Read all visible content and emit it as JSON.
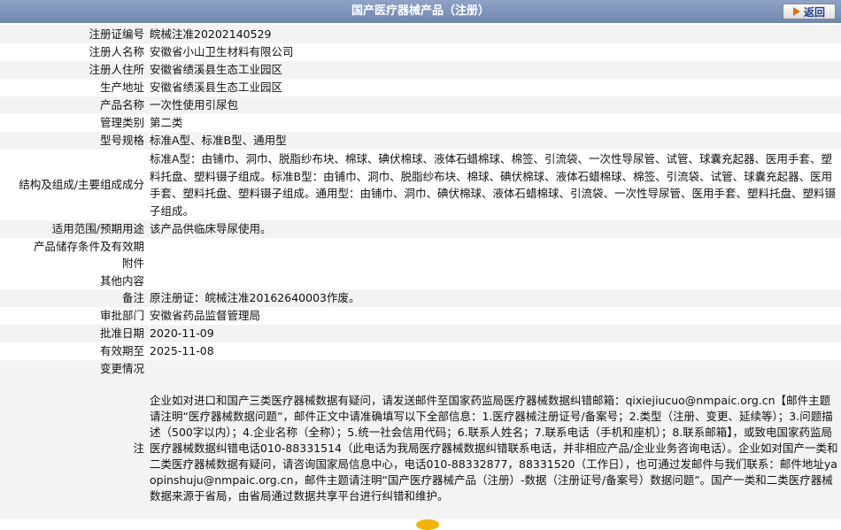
{
  "header": {
    "title": "国产医疗器械产品（注册）",
    "back_label": "返回"
  },
  "rows": [
    {
      "label": "注册证编号",
      "value": "皖械注准20202140529"
    },
    {
      "label": "注册人名称",
      "value": "安徽省小山卫生材料有限公司"
    },
    {
      "label": "注册人住所",
      "value": "安徽省绩溪县生态工业园区"
    },
    {
      "label": "生产地址",
      "value": "安徽省绩溪县生态工业园区"
    },
    {
      "label": "产品名称",
      "value": "一次性使用引尿包"
    },
    {
      "label": "管理类别",
      "value": "第二类"
    },
    {
      "label": "型号规格",
      "value": "标准A型、标准B型、通用型"
    },
    {
      "label": "结构及组成/主要组成成分",
      "value": "标准A型：由铺巾、洞巾、脱脂纱布块、棉球、碘伏棉球、液体石蜡棉球、棉签、引流袋、一次性导尿管、试管、球囊充起器、医用手套、塑料托盘、塑料镊子组成。标准B型：由铺巾、洞巾、脱脂纱布块、棉球、碘伏棉球、液体石蜡棉球、棉签、引流袋、试管、球囊充起器、医用手套、塑料托盘、塑料镊子组成。通用型：由铺巾、洞巾、碘伏棉球、液体石蜡棉球、引流袋、一次性导尿管、医用手套、塑料托盘、塑料镊子组成。"
    },
    {
      "label": "适用范围/预期用途",
      "value": "该产品供临床导尿使用。"
    },
    {
      "label": "产品储存条件及有效期",
      "value": ""
    },
    {
      "label": "附件",
      "value": ""
    },
    {
      "label": "其他内容",
      "value": ""
    },
    {
      "label": "备注",
      "value": "原注册证：皖械注准20162640003作废。"
    },
    {
      "label": "审批部门",
      "value": "安徽省药品监督管理局"
    },
    {
      "label": "批准日期",
      "value": "2020-11-09"
    },
    {
      "label": "有效期至",
      "value": "2025-11-08"
    },
    {
      "label": "变更情况",
      "value": ""
    }
  ],
  "notes": {
    "label": "注",
    "text": "企业如对进口和国产三类医疗器械数据有疑问，请发送邮件至国家药监局医疗器械数据纠错邮箱：qixiejiucuo@nmpaic.org.cn【邮件主题请注明“医疗器械数据问题”，邮件正文中请准确填写以下全部信息：1.医疗器械注册证号/备案号；2.类型（注册、变更、延续等）；3.问题描述（500字以内）；4.企业名称（全称）；5.统一社会信用代码；6.联系人姓名；7.联系电话（手机和座机）；8.联系邮箱】，或致电国家药监局医疗器械数据纠错电话010-88331514（此电话为我局医疗器械数据纠错联系电话，并非相应产品/企业业务咨询电话）。企业如对国产一类和二类医疗器械数据有疑问，请咨询国家局信息中心，电话010-88332877，88331520（工作日），也可通过发邮件与我们联系：邮件地址yaopinshuju@nmpaic.org.cn，邮件主题请注明“国产医疗器械产品（注册）-数据（注册证号/备案号）数据问题”。国产一类和二类医疗器械数据来源于省局，由省局通过数据共享平台进行纠错和维护。"
  },
  "colors": {
    "header_bg": "#7f95bd",
    "row_alt_bg": "#f3f3f3",
    "back_arrow": "#d87500"
  }
}
